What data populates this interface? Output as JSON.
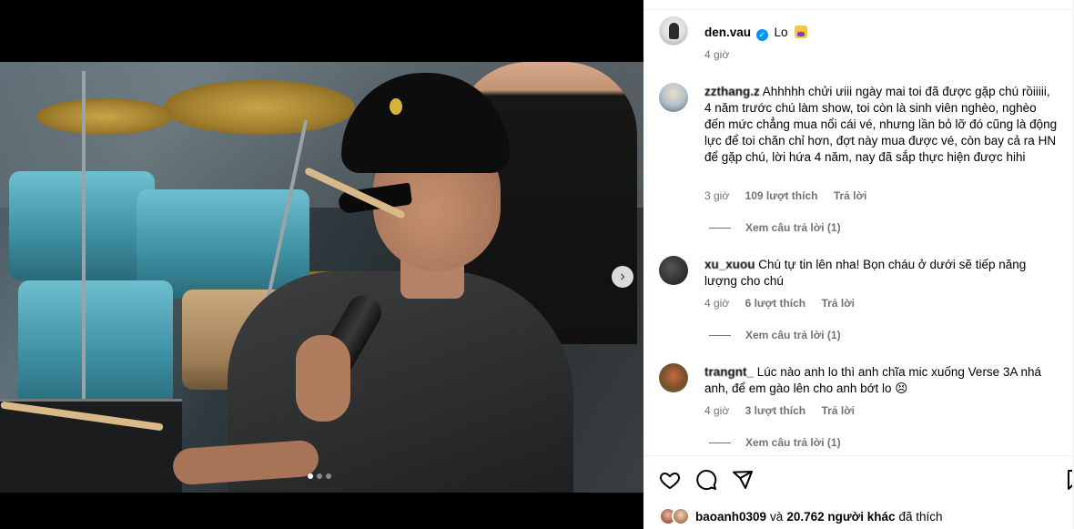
{
  "post": {
    "author": "den.vau",
    "caption": "Lo",
    "time": "4 giờ",
    "nav_next": "›",
    "verified": "✓"
  },
  "comments": [
    {
      "user": "zzthang.z",
      "text": "Ahhhhh chửi ưiii ngày mai toi đã được gặp chú rồiiiii, 4 năm trước chú làm show, toi còn là sinh viên nghèo, nghèo đến mức chẳng mua nổi cái vé, nhưng lần bỏ lỡ đó cũng là động lực để toi chăn chỉ hơn, đợt này mua được vé, còn bay cả ra HN để gặp chú, lời hứa 4 năm, nay đã sắp thực hiện được hihi",
      "time": "3 giờ",
      "likes": "109 lượt thích",
      "reply": "Trả lời",
      "view_replies": "Xem câu trả lời (1)"
    },
    {
      "user": "xu_xuou",
      "text": "Chú tự tin lên nha! Bọn cháu ở dưới sẽ tiếp năng lượng cho chú",
      "time": "4 giờ",
      "likes": "6 lượt thích",
      "reply": "Trả lời",
      "view_replies": "Xem câu trả lời (1)"
    },
    {
      "user": "trangnt_",
      "text": "Lúc nào anh lo thì anh chĩa mic xuống Verse 3A nhá anh, để em gào lên cho anh bớt lo 😣",
      "time": "4 giờ",
      "likes": "3 lượt thích",
      "reply": "Trả lời",
      "view_replies": "Xem câu trả lời (1)"
    }
  ],
  "likes_summary": {
    "user": "baoanh0309",
    "connector": "và",
    "others": "20.762 người khác",
    "suffix": "đã thích"
  },
  "carousel": {
    "total": 3,
    "active": 1
  },
  "colors": {
    "verified": "#0095f6",
    "secondary_text": "#737373"
  },
  "icons": [
    "heart-icon",
    "comment-icon",
    "share-icon",
    "bookmark-icon",
    "chevron-right-icon"
  ]
}
